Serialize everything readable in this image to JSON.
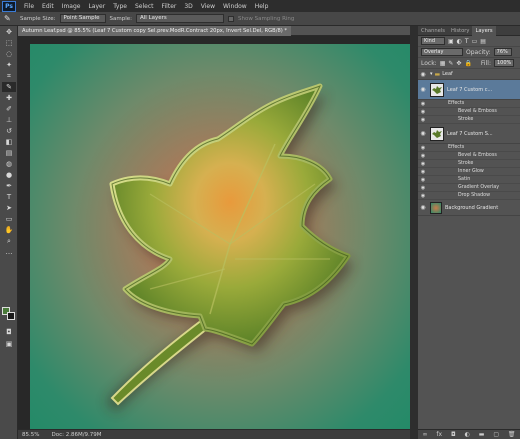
{
  "app": {
    "logo": "Ps",
    "menu": [
      "File",
      "Edit",
      "Image",
      "Layer",
      "Type",
      "Select",
      "Filter",
      "3D",
      "View",
      "Window",
      "Help"
    ]
  },
  "options": {
    "sample_size_label": "Sample Size:",
    "sample_size_value": "Point Sample",
    "sample_label": "Sample:",
    "sample_value": "All Layers",
    "show_ring_label": "Show Sampling Ring"
  },
  "document": {
    "tab_title": "Autumn Leaf.psd @ 85.5% (Leaf 7 Custom copy Sel.prev.ModR.Contract 20px, Invert Sel.Del, RGB/8) *",
    "zoom": "85.5%",
    "doc_info": "Doc: 2.86M/9.79M"
  },
  "panel": {
    "tabs": [
      "Channels",
      "History",
      "Layers"
    ],
    "kind_label": "Kind",
    "blend_mode": "Overlay",
    "opacity_label": "Opacity:",
    "opacity_value": "76%",
    "lock_label": "Lock:",
    "fill_label": "Fill:",
    "fill_value": "100%",
    "group_name": "Leaf",
    "layer1": {
      "name": "Leaf 7 Custom c...",
      "effects_label": "Effects",
      "effects": [
        "Bevel & Emboss",
        "Stroke"
      ]
    },
    "layer2": {
      "name": "Leaf 7 Custom S...",
      "effects_label": "Effects",
      "effects": [
        "Bevel & Emboss",
        "Stroke",
        "Inner Glow",
        "Satin",
        "Gradient Overlay",
        "Drop Shadow"
      ]
    },
    "layer3": {
      "name": "Background Gradient"
    }
  },
  "colors": {
    "accent": "#5b7a9a",
    "leaf_light": "#c8d070",
    "leaf_dark": "#4f7a24",
    "canvas_center": "#c97a4a",
    "canvas_edge": "#248a68"
  }
}
